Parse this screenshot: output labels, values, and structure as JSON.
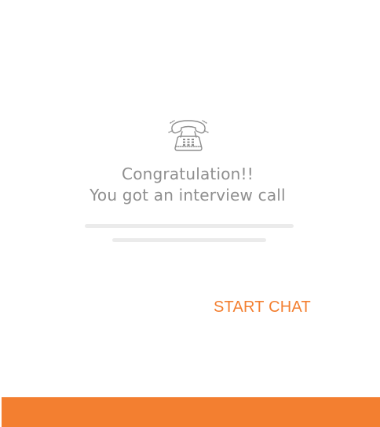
{
  "dialog": {
    "icon": "telephone-icon",
    "title_line1": "Congratulation!!",
    "title_line2": "You got an interview call",
    "action_label": "START CHAT"
  },
  "colors": {
    "accent": "#f37f30",
    "text_muted": "#8e8e8e",
    "placeholder": "#ebebeb",
    "background": "#ffffff"
  }
}
